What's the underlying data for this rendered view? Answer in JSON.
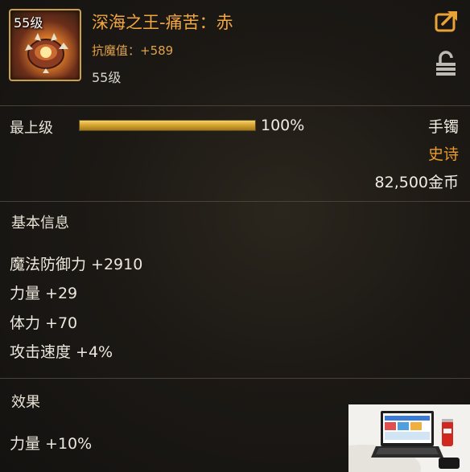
{
  "item": {
    "icon_level": "55级",
    "name": "深海之王-痛苦：赤",
    "resist": "抗魔值：+589",
    "required_level": "55级",
    "icon": "spiked-fist-icon"
  },
  "upgrade": {
    "label": "最上级",
    "percent_text": "100%",
    "fill_fraction": 1.0
  },
  "meta": {
    "slot": "手镯",
    "rarity": "史诗",
    "price": "82,500金币",
    "rarity_color": "#e89b2e",
    "title_color": "#f2a640"
  },
  "basic": {
    "header": "基本信息",
    "stats": [
      "魔法防御力 +2910",
      "力量 +29",
      "体力 +70",
      "攻击速度 +4%"
    ]
  },
  "effect": {
    "header": "效果",
    "stats": [
      "力量 +10%"
    ]
  },
  "icons": {
    "share": "share-icon",
    "lock": "lock-icon"
  }
}
